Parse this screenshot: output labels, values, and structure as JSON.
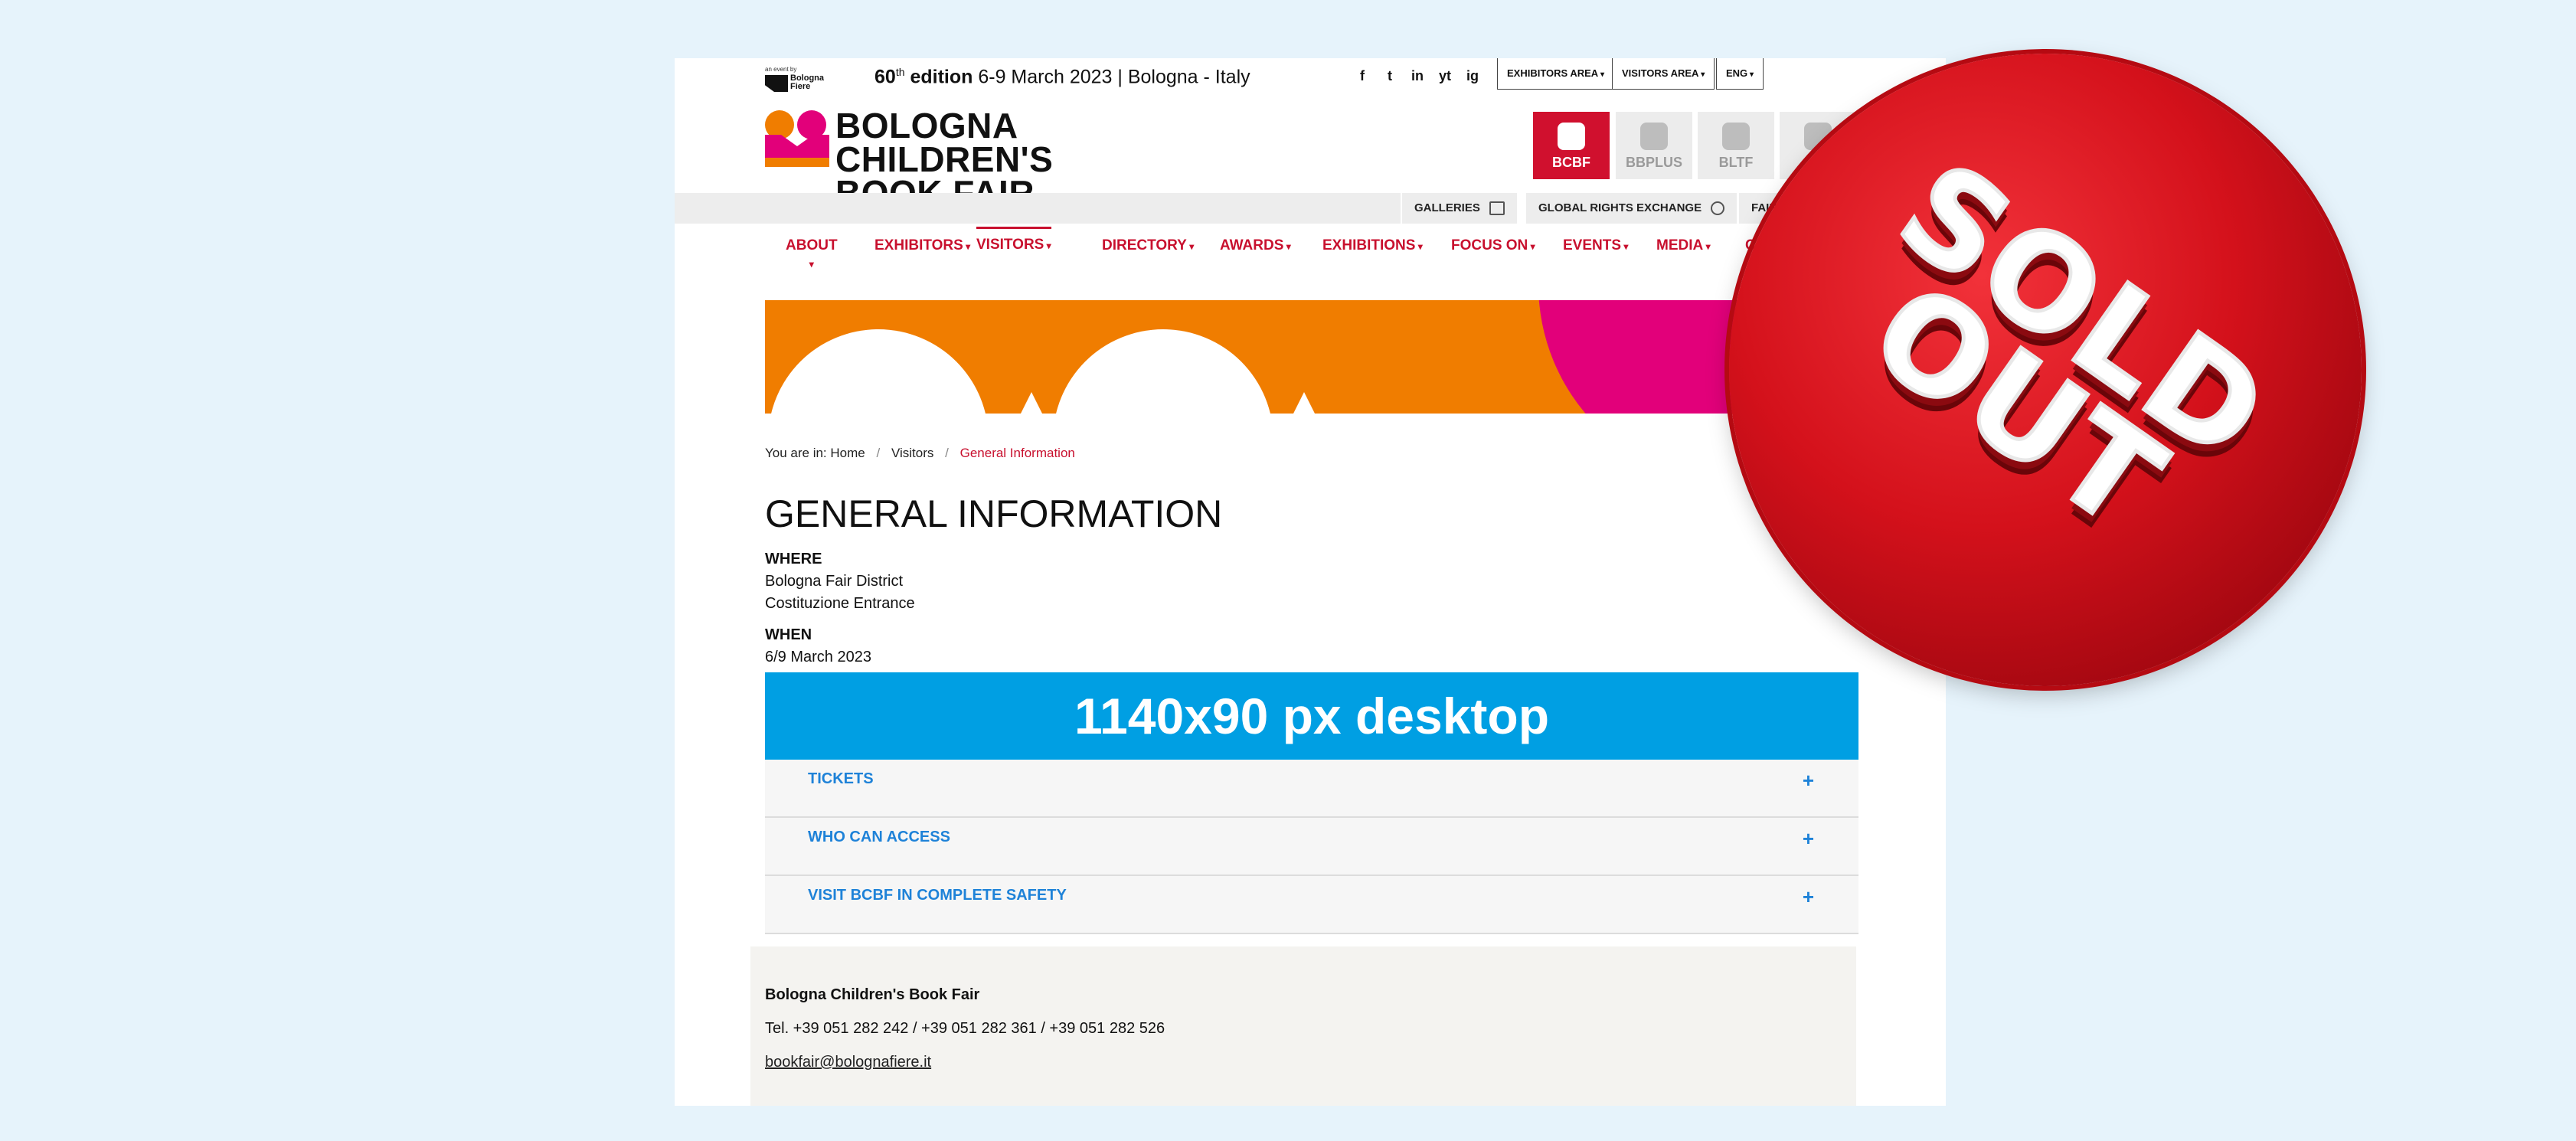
{
  "topbar": {
    "event_by": "an event by",
    "event_by_brand": "Bologna Fiere",
    "edition_num": "60",
    "edition_sup": "th",
    "edition_word": "edition",
    "edition_rest": "6-9 March 2023 | Bologna - Italy",
    "social": [
      "f",
      "t",
      "in",
      "yt",
      "ig"
    ],
    "dropdowns": [
      "EXHIBITORS AREA",
      "VISITORS AREA",
      "ENG"
    ]
  },
  "logo": {
    "line1": "BOLOGNA CHILDREN'S",
    "line2": "BOOK FAIR"
  },
  "tiles": [
    "BCBF",
    "BBPLUS",
    "BLTF"
  ],
  "strip": {
    "galleries": "GALLERIES",
    "rights": "GLOBAL RIGHTS EXCHANGE",
    "fair": "FAIR"
  },
  "nav": [
    "ABOUT",
    "EXHIBITORS",
    "VISITORS",
    "DIRECTORY",
    "AWARDS",
    "EXHIBITIONS",
    "FOCUS ON",
    "EVENTS",
    "MEDIA",
    "C"
  ],
  "breadcrumb": {
    "prefix": "You are in:",
    "home": "Home",
    "visitors": "Visitors",
    "current": "General Information"
  },
  "page_title": "GENERAL INFORMATION",
  "where": {
    "label": "WHERE",
    "line1": "Bologna Fair District",
    "line2": "Costituzione Entrance"
  },
  "when": {
    "label": "WHEN",
    "value": "6/9 March 2023"
  },
  "ad_text": "1140x90 px desktop",
  "accordion": [
    "TICKETS",
    "WHO CAN ACCESS",
    "VISIT BCBF IN COMPLETE SAFETY"
  ],
  "accordion_toggle": "+",
  "footer": {
    "name": "Bologna Children's Book Fair",
    "tel": "Tel. +39 051 282 242 / +39 051 282 361 / +39 051 282 526",
    "email": "bookfair@bolognafiere.it"
  },
  "sticker": {
    "line1": "SOLD",
    "line2": "OUT"
  },
  "colors": {
    "brand_red": "#c8102e",
    "link_blue": "#1e82d8",
    "ad_blue": "#009fe3",
    "orange": "#f07d00",
    "magenta": "#e2007a"
  }
}
